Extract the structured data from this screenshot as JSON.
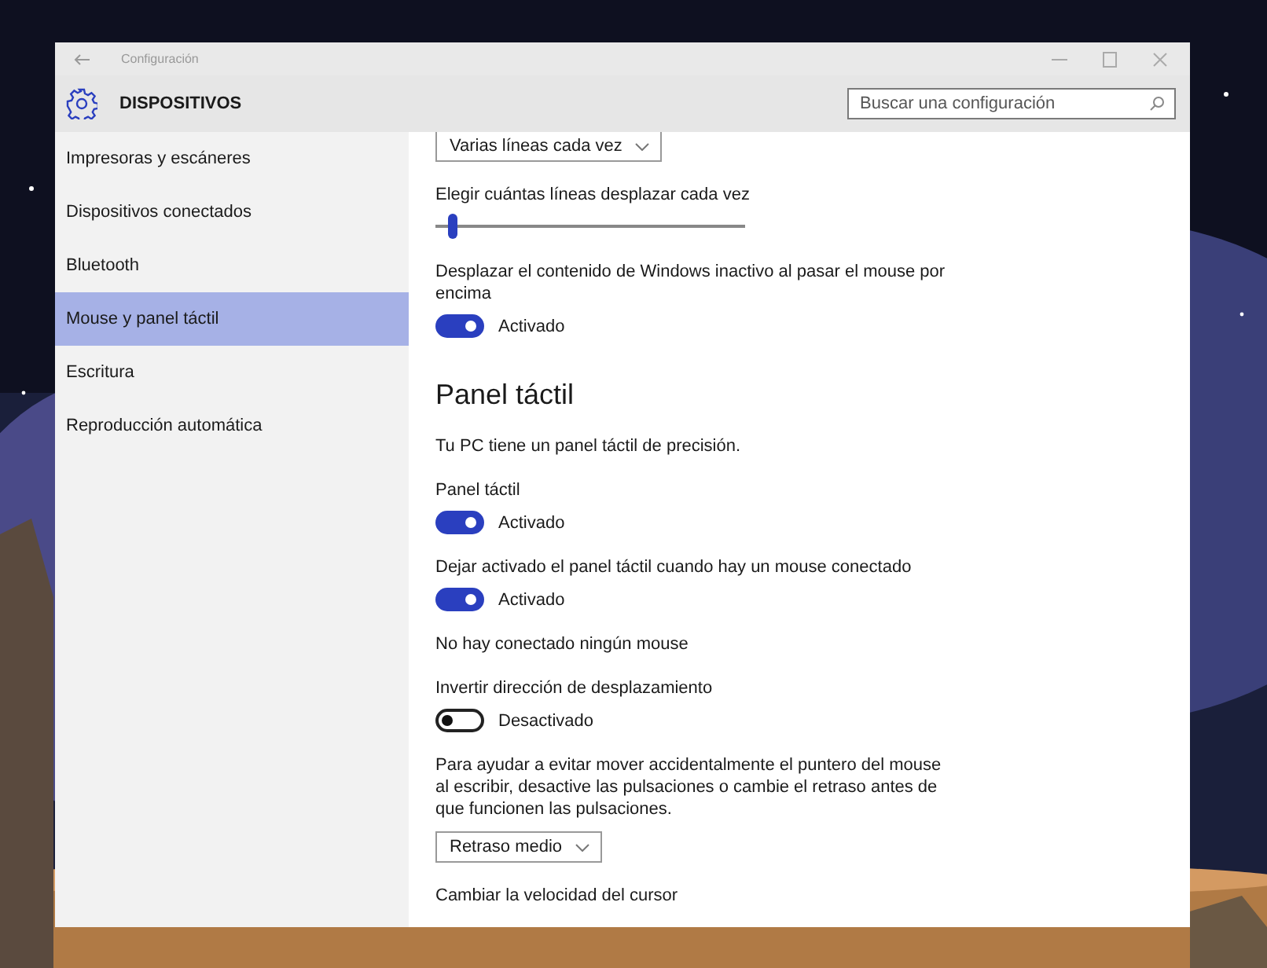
{
  "window": {
    "title": "Configuración"
  },
  "header": {
    "title": "DISPOSITIVOS",
    "search": {
      "placeholder": "Buscar una configuración"
    }
  },
  "sidebar": {
    "items": [
      {
        "label": "Impresoras y escáneres",
        "selected": false
      },
      {
        "label": "Dispositivos conectados",
        "selected": false
      },
      {
        "label": "Bluetooth",
        "selected": false
      },
      {
        "label": "Mouse y panel táctil",
        "selected": true
      },
      {
        "label": "Escritura",
        "selected": false
      },
      {
        "label": "Reproducción automática",
        "selected": false
      }
    ]
  },
  "content": [
    {
      "kind": "dropdown",
      "value": "Varias líneas cada vez"
    },
    {
      "kind": "label",
      "text": "Elegir cuántas líneas desplazar cada vez"
    },
    {
      "kind": "slider",
      "level": 0.04
    },
    {
      "kind": "label",
      "text": "Desplazar el contenido de Windows inactivo al pasar el mouse por encima"
    },
    {
      "kind": "toggle",
      "on": true,
      "text": "Activado"
    },
    {
      "kind": "heading",
      "text": "Panel táctil"
    },
    {
      "kind": "text",
      "text": "Tu PC tiene un panel táctil de precisión."
    },
    {
      "kind": "label",
      "text": "Panel táctil"
    },
    {
      "kind": "toggle",
      "on": true,
      "text": "Activado"
    },
    {
      "kind": "label",
      "text": "Dejar activado el panel táctil cuando hay un mouse conectado"
    },
    {
      "kind": "toggle",
      "on": true,
      "text": "Activado"
    },
    {
      "kind": "text",
      "text": "No hay conectado ningún mouse"
    },
    {
      "kind": "label",
      "text": "Invertir dirección de desplazamiento"
    },
    {
      "kind": "toggle",
      "on": false,
      "text": "Desactivado"
    },
    {
      "kind": "text",
      "text": "Para ayudar a evitar mover accidentalmente el puntero del mouse al escribir, desactive las pulsaciones o cambie el retraso antes de que funcionen las pulsaciones."
    },
    {
      "kind": "dropdown",
      "value": "Retraso medio"
    },
    {
      "kind": "text",
      "text": "Cambiar la velocidad del cursor"
    }
  ]
}
